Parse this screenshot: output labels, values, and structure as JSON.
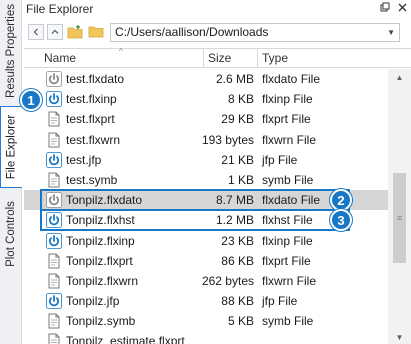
{
  "tabs": {
    "results_properties": "Results Properties",
    "file_explorer": "File Explorer",
    "plot_controls": "Plot Controls"
  },
  "panel": {
    "title": "File Explorer",
    "pin_icon": "pin-icon",
    "close_icon": "close-icon"
  },
  "toolbar": {
    "path": "C:/Users/aallison/Downloads"
  },
  "columns": {
    "name": "Name",
    "size": "Size",
    "type": "Type"
  },
  "rows": [
    {
      "name": "test.flxdato",
      "size": "2.6 MB",
      "type": "flxdato File",
      "icon": "power-gray"
    },
    {
      "name": "test.flxinp",
      "size": "8 KB",
      "type": "flxinp File",
      "icon": "power-blue"
    },
    {
      "name": "test.flxprt",
      "size": "29 KB",
      "type": "flxprt File",
      "icon": "document"
    },
    {
      "name": "test.flxwrn",
      "size": "193 bytes",
      "type": "flxwrn File",
      "icon": "document"
    },
    {
      "name": "test.jfp",
      "size": "21 KB",
      "type": "jfp File",
      "icon": "power-blue"
    },
    {
      "name": "test.symb",
      "size": "1 KB",
      "type": "symb File",
      "icon": "document"
    },
    {
      "name": "Tonpilz.flxdato",
      "size": "8.7 MB",
      "type": "flxdato File",
      "icon": "power-gray"
    },
    {
      "name": "Tonpilz.flxhst",
      "size": "1.2 MB",
      "type": "flxhst File",
      "icon": "power-blue"
    },
    {
      "name": "Tonpilz.flxinp",
      "size": "23 KB",
      "type": "flxinp File",
      "icon": "power-blue"
    },
    {
      "name": "Tonpilz.flxprt",
      "size": "86 KB",
      "type": "flxprt File",
      "icon": "document"
    },
    {
      "name": "Tonpilz.flxwrn",
      "size": "262 bytes",
      "type": "flxwrn File",
      "icon": "document"
    },
    {
      "name": "Tonpilz.jfp",
      "size": "88 KB",
      "type": "jfp File",
      "icon": "power-blue"
    },
    {
      "name": "Tonpilz.symb",
      "size": "5 KB",
      "type": "symb File",
      "icon": "document"
    },
    {
      "name": "Tonpilz_estimate.flxprt",
      "size": "",
      "type": "",
      "icon": "document"
    }
  ],
  "callouts": [
    "1",
    "2",
    "3"
  ],
  "colors": {
    "accent": "#1878c6",
    "selection": "#d6d6d6",
    "power_blue": "#1878c6",
    "power_gray": "#8a8a8a"
  }
}
